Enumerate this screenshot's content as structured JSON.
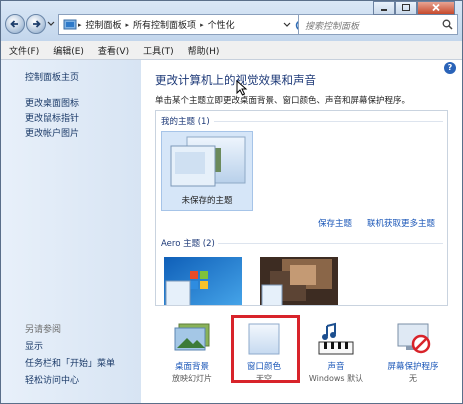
{
  "address": {
    "crumbs": [
      "控制面板",
      "所有控制面板项",
      "个性化"
    ],
    "search_placeholder": "搜索控制面板"
  },
  "menu": [
    "文件(F)",
    "编辑(E)",
    "查看(V)",
    "工具(T)",
    "帮助(H)"
  ],
  "sidebar": {
    "home": "控制面板主页",
    "links": [
      "更改桌面图标",
      "更改鼠标指针",
      "更改帐户图片"
    ],
    "see_also_title": "另请参阅",
    "see_also": [
      "显示",
      "任务栏和「开始」菜单",
      "轻松访问中心"
    ]
  },
  "main": {
    "title": "更改计算机上的视觉效果和声音",
    "description": "单击某个主题立即更改桌面背景、窗口颜色、声音和屏幕保护程序。",
    "help": "?",
    "my_themes_header": "我的主题 (1)",
    "unsaved_theme": "未保存的主题",
    "save_theme": "保存主题",
    "get_more": "联机获取更多主题",
    "aero_header": "Aero 主题 (2)"
  },
  "options": [
    {
      "label": "桌面背景",
      "value": "放映幻灯片",
      "icon": "desktop-background-icon"
    },
    {
      "label": "窗口颜色",
      "value": "天空",
      "icon": "window-color-icon"
    },
    {
      "label": "声音",
      "value": "Windows 默认",
      "icon": "sound-icon"
    },
    {
      "label": "屏幕保护程序",
      "value": "无",
      "icon": "screensaver-icon"
    }
  ],
  "colors": {
    "title_blue": "#1e3a78",
    "link_blue": "#1b57b8",
    "highlight_red": "#d8232a"
  }
}
